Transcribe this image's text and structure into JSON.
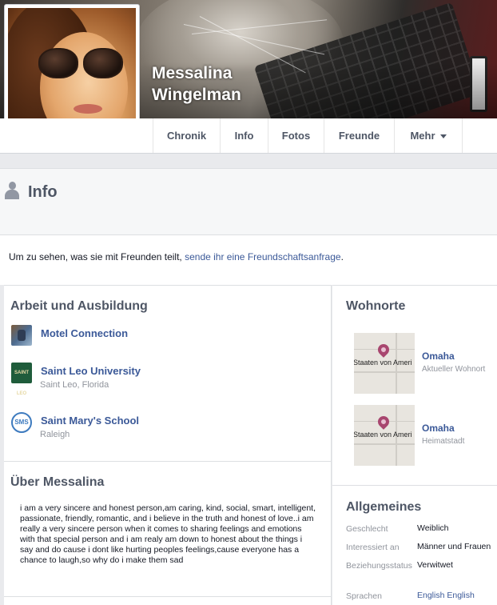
{
  "profile": {
    "name_line1": "Messalina",
    "name_line2": "Wingelman"
  },
  "tabs": [
    {
      "label": "Chronik"
    },
    {
      "label": "Info"
    },
    {
      "label": "Fotos"
    },
    {
      "label": "Freunde"
    },
    {
      "label": "Mehr"
    }
  ],
  "info": {
    "title": "Info",
    "notice_text": "Um zu sehen, was sie mit Freunden teilt, ",
    "notice_link": "sende ihr eine Freundschaftsanfrage",
    "notice_end": "."
  },
  "work": {
    "title": "Arbeit und Ausbildung",
    "items": [
      {
        "name": "Motel Connection",
        "sub": "",
        "logo": "motel-connection-logo"
      },
      {
        "name": "Saint Leo University",
        "sub": "Saint Leo, Florida",
        "logo": "saint-leo-logo"
      },
      {
        "name": "Saint Mary's School",
        "sub": "Raleigh",
        "logo": "sms-logo"
      }
    ],
    "logo_text": {
      "leo": "SAINT LEO",
      "sms": "SMS"
    }
  },
  "about": {
    "title": "Über Messalina",
    "text": "i am a very sincere and honest person,am caring, kind, social, smart, intelligent, passionate, friendly, romantic, and i believe in the truth and honest of love..i am really a very sincere person when it comes to sharing feelings and emotions with that special person and i am realy am down to honest about the things i say and do cause i dont like hurting peoples feelings,cause everyone has a chance to laugh,so why do i make them sad"
  },
  "places": {
    "title": "Wohnorte",
    "items": [
      {
        "name": "Omaha",
        "sub": "Aktueller Wohnort",
        "map_label": "Staaten von Ameri"
      },
      {
        "name": "Omaha",
        "sub": "Heimatstadt",
        "map_label": "Staaten von Ameri"
      }
    ]
  },
  "general": {
    "title": "Allgemeines",
    "rows": [
      {
        "label": "Geschlecht",
        "value": "Weiblich"
      },
      {
        "label": "Interessiert an",
        "value": "Männer und Frauen"
      },
      {
        "label": "Beziehungsstatus",
        "value": "Verwitwet"
      },
      {
        "label": "Sprachen",
        "value": "English English"
      }
    ]
  },
  "colors": {
    "link": "#3b5998",
    "muted": "#90949c",
    "header_text": "#4e5665",
    "page_bg": "#e9eaed"
  }
}
